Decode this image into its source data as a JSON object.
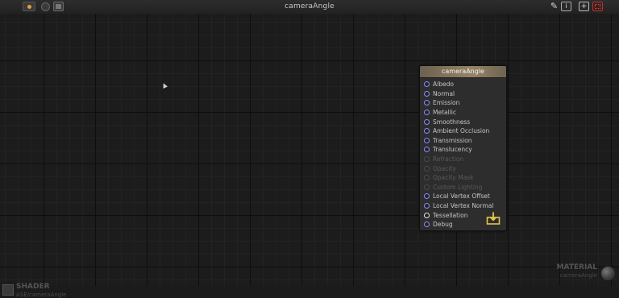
{
  "window": {
    "title": "cameraAngle"
  },
  "toolbar": {
    "live_icon": "live-preview-icon",
    "circle_icon": "clean-icon",
    "film_icon": "media-icon",
    "right_buttons": {
      "paint_icon": "paint-brush-icon",
      "info_label": "i",
      "focus_label": "+",
      "grid_icon": "grid-icon"
    }
  },
  "node": {
    "title": "cameraAngle",
    "ports": [
      {
        "label": "Albedo",
        "enabled": true
      },
      {
        "label": "Normal",
        "enabled": true
      },
      {
        "label": "Emission",
        "enabled": true
      },
      {
        "label": "Metallic",
        "enabled": true
      },
      {
        "label": "Smoothness",
        "enabled": true
      },
      {
        "label": "Ambient Occlusion",
        "enabled": true
      },
      {
        "label": "Transmission",
        "enabled": true
      },
      {
        "label": "Translucency",
        "enabled": true
      },
      {
        "label": "Refraction",
        "enabled": false
      },
      {
        "label": "Opacity",
        "enabled": false
      },
      {
        "label": "Opacity Mask",
        "enabled": false
      },
      {
        "label": "Custom Lighting",
        "enabled": false
      },
      {
        "label": "Local Vertex Offset",
        "enabled": true
      },
      {
        "label": "Local Vertex Normal",
        "enabled": true
      },
      {
        "label": "Tessellation",
        "enabled": true
      },
      {
        "label": "Debug",
        "enabled": true
      }
    ],
    "export_icon": "download-icon",
    "colors": {
      "header": "#958365",
      "port": "#8b8fe0",
      "export": "#e8c44a"
    }
  },
  "footer": {
    "shader_label": "SHADER",
    "shader_path": "ASE/cameraAngle",
    "material_label": "MATERIAL",
    "material_name": "cameraAngle"
  }
}
